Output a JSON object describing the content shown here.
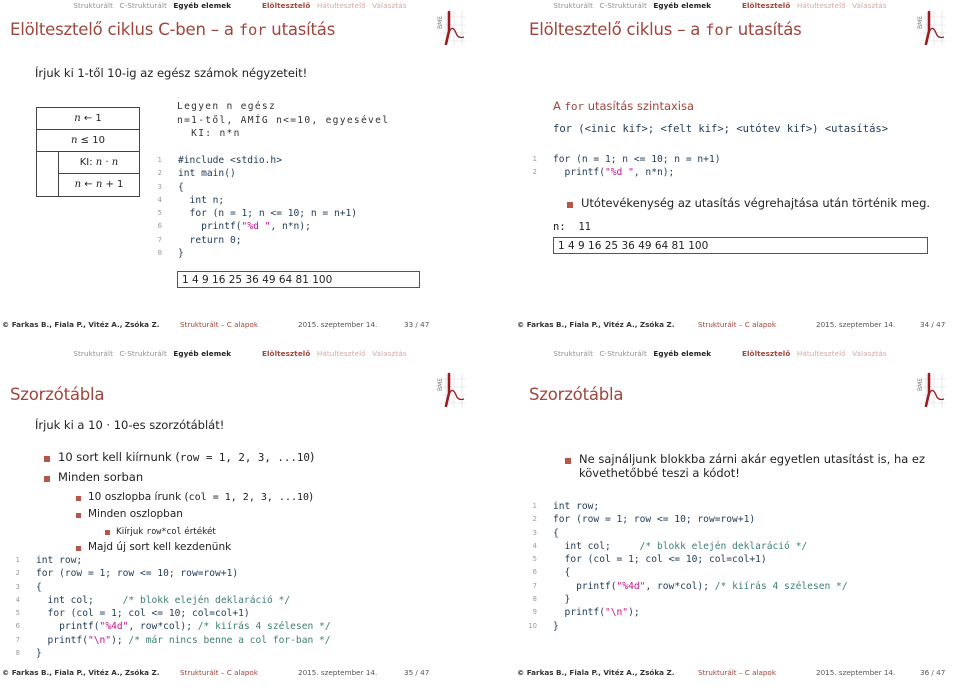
{
  "nav": {
    "items": [
      "Strukturált",
      "C-Strukturált",
      "Egyéb elemek",
      "Elöltesztelő",
      "Hátultesztelő",
      "Választás"
    ]
  },
  "logo": {
    "text": "BME",
    "icon": "bme-logo-icon"
  },
  "footer": {
    "authors": "© Farkas B., Fiala P., Vitéz A., Zsóka Z.",
    "course": "Strukturált – C alapok",
    "date": "2015. szeptember 14.",
    "total_pages": "47"
  },
  "colors": {
    "accent": "#a0453c",
    "bullet": "#b5564b",
    "string": "#c0148a",
    "comment": "#3e7f73",
    "code": "#1f3a55"
  },
  "slides": [
    {
      "page": "33 / 47",
      "title_pre": "Elöltesztelő ciklus C-ben – a ",
      "title_code": "for",
      "title_post": " utasítás",
      "intro": "Írjuk ki 1-től 10-ig az egész számok négyzeteit!",
      "structogram": {
        "init": "n ← 1",
        "condition": "n ≤ 10",
        "body": [
          "KI: n · n",
          "n ← n + 1"
        ]
      },
      "pseudocode": [
        "Legyen n egész",
        "n=1-től, AMÍG n<=10, egyesével",
        "  KI: n*n"
      ],
      "code": [
        {
          "n": "1",
          "parts": [
            [
              "pp",
              "#include <stdio.h>"
            ]
          ]
        },
        {
          "n": "2",
          "parts": [
            [
              "kw",
              "int main()"
            ]
          ]
        },
        {
          "n": "3",
          "parts": [
            [
              "kw",
              "{"
            ]
          ]
        },
        {
          "n": "4",
          "parts": [
            [
              "kw",
              "  int n;"
            ]
          ]
        },
        {
          "n": "5",
          "parts": [
            [
              "kw",
              "  for (n = 1; n <= 10; n = n+1)"
            ]
          ]
        },
        {
          "n": "6",
          "parts": [
            [
              "kw",
              "    printf("
            ],
            [
              "str",
              "\"%d \""
            ],
            [
              "kw",
              ", n*n);"
            ]
          ]
        },
        {
          "n": "7",
          "parts": [
            [
              "kw",
              "  return 0;"
            ]
          ]
        },
        {
          "n": "8",
          "parts": [
            [
              "kw",
              "}"
            ]
          ]
        }
      ],
      "output": "1 4 9 16 25 36 49 64 81 100"
    },
    {
      "page": "34 / 47",
      "title_pre": "Elöltesztelő ciklus – a ",
      "title_code": "for",
      "title_post": " utasítás",
      "syntax_title_pre": "A ",
      "syntax_title_code": "for",
      "syntax_title_post": " utasítás szintaxisa",
      "syntax": "for (<inic kif>; <felt kif>; <utótev kif>) <utasítás>",
      "code": [
        {
          "n": "1",
          "parts": [
            [
              "kw",
              "for (n = 1; n <= 10; n = n+1)"
            ]
          ]
        },
        {
          "n": "2",
          "parts": [
            [
              "kw",
              "  printf("
            ],
            [
              "str",
              "\"%d \""
            ],
            [
              "kw",
              ", n*n);"
            ]
          ]
        }
      ],
      "bullet": "Utótevékenység az utasítás végrehajtása után történik meg.",
      "n_label": "n:",
      "n_value": "11",
      "output": "1 4 9 16 25 36 49 64 81 100"
    },
    {
      "page": "35 / 47",
      "title": "Szorzótábla",
      "intro": "Írjuk ki a 10 · 10-es szorzótáblát!",
      "bullets": [
        {
          "level": 1,
          "pre": "10 sort kell kiírnunk (",
          "code": "row = 1, 2, 3, ...10",
          "post": ")"
        },
        {
          "level": 1,
          "pre": "Minden sorban",
          "code": "",
          "post": ""
        },
        {
          "level": 2,
          "pre": "10 oszlopba írunk (",
          "code": "col = 1, 2, 3, ...10",
          "post": ")"
        },
        {
          "level": 2,
          "pre": "Minden oszlopban",
          "code": "",
          "post": ""
        },
        {
          "level": 3,
          "pre": "Kiírjuk ",
          "code": "row*col",
          "post": " értékét"
        },
        {
          "level": 2,
          "pre": "Majd új sort kell kezdenünk",
          "code": "",
          "post": ""
        }
      ],
      "code": [
        {
          "n": "1",
          "parts": [
            [
              "kw",
              "int row;"
            ]
          ]
        },
        {
          "n": "2",
          "parts": [
            [
              "kw",
              "for (row = 1; row <= 10; row=row+1)"
            ]
          ]
        },
        {
          "n": "3",
          "parts": [
            [
              "kw",
              "{"
            ]
          ]
        },
        {
          "n": "4",
          "parts": [
            [
              "kw",
              "  int col;     "
            ],
            [
              "cm",
              "/* blokk elején deklaráció */"
            ]
          ]
        },
        {
          "n": "5",
          "parts": [
            [
              "kw",
              "  for (col = 1; col <= 10; col=col+1)"
            ]
          ]
        },
        {
          "n": "6",
          "parts": [
            [
              "kw",
              "    printf("
            ],
            [
              "str",
              "\"%4d\""
            ],
            [
              "kw",
              ", row*col); "
            ],
            [
              "cm",
              "/* kiírás 4 szélesen */"
            ]
          ]
        },
        {
          "n": "7",
          "parts": [
            [
              "kw",
              "  printf("
            ],
            [
              "str",
              "\"\\n\""
            ],
            [
              "kw",
              "); "
            ],
            [
              "cm",
              "/* már nincs benne a col for-ban */"
            ]
          ]
        },
        {
          "n": "8",
          "parts": [
            [
              "kw",
              "}"
            ]
          ]
        }
      ]
    },
    {
      "page": "36 / 47",
      "title": "Szorzótábla",
      "bullet_line1": "Ne sajnáljunk blokkba zárni akár egyetlen utasítást is, ha ez",
      "bullet_line2": "követhetőbbé teszi a kódot!",
      "code": [
        {
          "n": "1",
          "parts": [
            [
              "kw",
              "int row;"
            ]
          ]
        },
        {
          "n": "2",
          "parts": [
            [
              "kw",
              "for (row = 1; row <= 10; row=row+1)"
            ]
          ]
        },
        {
          "n": "3",
          "parts": [
            [
              "kw",
              "{"
            ]
          ]
        },
        {
          "n": "4",
          "parts": [
            [
              "kw",
              "  int col;     "
            ],
            [
              "cm",
              "/* blokk elején deklaráció */"
            ]
          ]
        },
        {
          "n": "5",
          "parts": [
            [
              "kw",
              "  for (col = 1; col <= 10; col=col+1)"
            ]
          ]
        },
        {
          "n": "6",
          "parts": [
            [
              "kw",
              "  {"
            ]
          ]
        },
        {
          "n": "7",
          "parts": [
            [
              "kw",
              "    printf("
            ],
            [
              "str",
              "\"%4d\""
            ],
            [
              "kw",
              ", row*col); "
            ],
            [
              "cm",
              "/* kiírás 4 szélesen */"
            ]
          ]
        },
        {
          "n": "8",
          "parts": [
            [
              "kw",
              "  }"
            ]
          ]
        },
        {
          "n": "9",
          "parts": [
            [
              "kw",
              "  printf("
            ],
            [
              "str",
              "\"\\n\""
            ],
            [
              "kw",
              ");"
            ]
          ]
        },
        {
          "n": "10",
          "parts": [
            [
              "kw",
              "}"
            ]
          ]
        }
      ]
    }
  ]
}
